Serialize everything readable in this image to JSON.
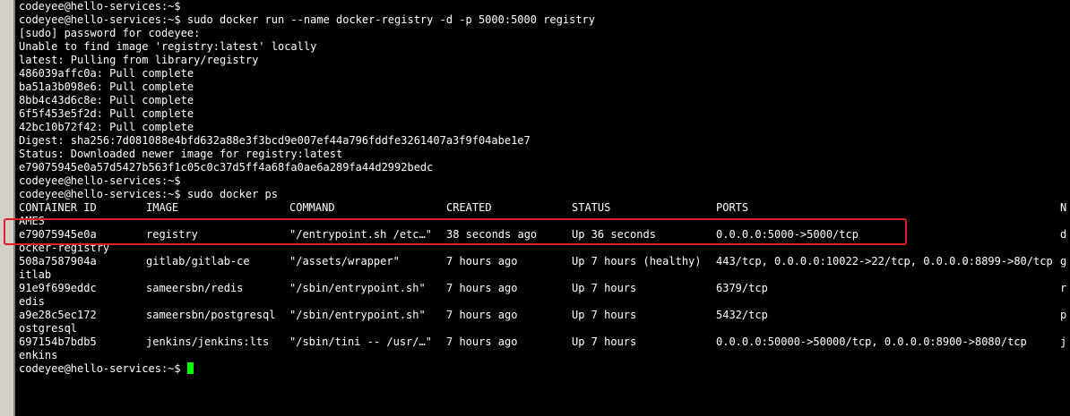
{
  "terminal": {
    "lines_top": [
      "codeyee@hello-services:~$",
      "codeyee@hello-services:~$ sudo docker run --name docker-registry -d -p 5000:5000 registry",
      "[sudo] password for codeyee:",
      "Unable to find image 'registry:latest' locally",
      "latest: Pulling from library/registry",
      "486039affc0a: Pull complete",
      "ba51a3b098e6: Pull complete",
      "8bb4c43d6c8e: Pull complete",
      "6f5f453e5f2d: Pull complete",
      "42bc10b72f42: Pull complete",
      "Digest: sha256:7d081088e4bfd632a88e3f3bcd9e007ef44a796fddfe3261407a3f9f04abe1e7",
      "Status: Downloaded newer image for registry:latest",
      "e79075945e0a57d5427b563f1c05c0c37d5ff4a68fa0ae6a289fa44d2992bedc",
      "codeyee@hello-services:~$",
      "codeyee@hello-services:~$ sudo docker ps"
    ],
    "header": [
      "CONTAINER ID",
      "IMAGE",
      "COMMAND",
      "CREATED",
      "STATUS",
      "PORTS",
      "N"
    ],
    "header_wrap": "AMES",
    "rows": [
      {
        "cells": [
          "e79075945e0a",
          "registry",
          "\"/entrypoint.sh /etc…\"",
          "38 seconds ago",
          "Up 36 seconds",
          "0.0.0.0:5000->5000/tcp",
          "d"
        ],
        "wrap": "ocker-registry"
      },
      {
        "cells": [
          "508a7587904a",
          "gitlab/gitlab-ce",
          "\"/assets/wrapper\"",
          "7 hours ago",
          "Up 7 hours (healthy)",
          "443/tcp, 0.0.0.0:10022->22/tcp, 0.0.0.0:8899->80/tcp",
          "g"
        ],
        "wrap": "itlab"
      },
      {
        "cells": [
          "91e9f699eddc",
          "sameersbn/redis",
          "\"/sbin/entrypoint.sh\"",
          "7 hours ago",
          "Up 7 hours",
          "6379/tcp",
          "r"
        ],
        "wrap": "edis"
      },
      {
        "cells": [
          "a9e28c5ec172",
          "sameersbn/postgresql",
          "\"/sbin/entrypoint.sh\"",
          "7 hours ago",
          "Up 7 hours",
          "5432/tcp",
          "p"
        ],
        "wrap": "ostgresql"
      },
      {
        "cells": [
          "697154b7bdb5",
          "jenkins/jenkins:lts",
          "\"/sbin/tini -- /usr/…\"",
          "7 hours ago",
          "Up 7 hours",
          "0.0.0.0:50000->50000/tcp, 0.0.0.0:8900->8080/tcp",
          "j"
        ],
        "wrap": "enkins"
      }
    ],
    "final_prompt": "codeyee@hello-services:~$ ",
    "colors": {
      "background": "#000000",
      "foreground": "#ffffff",
      "cursor": "#00ff00",
      "highlight": "#e02020"
    }
  }
}
